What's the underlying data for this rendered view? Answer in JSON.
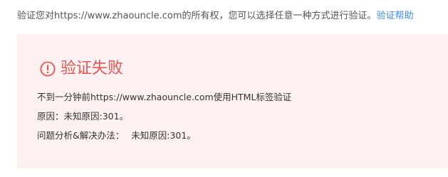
{
  "intro": {
    "text": "验证您对https://www.zhaouncle.com的所有权，您可以选择任意一种方式进行验证。",
    "help_link": "验证帮助"
  },
  "result": {
    "status_icon": "exclamation-circle-icon",
    "title": "验证失败",
    "accent_color": "#e8534f",
    "panel_color": "#fdf1f1",
    "time_line": "不到一分钟前https://www.zhaouncle.com使用HTML标签验证",
    "reason_label": "原因：",
    "reason_value": "未知原因:301。",
    "solution_label": "问题分析&解决办法：",
    "solution_value": "未知原因:301。"
  }
}
